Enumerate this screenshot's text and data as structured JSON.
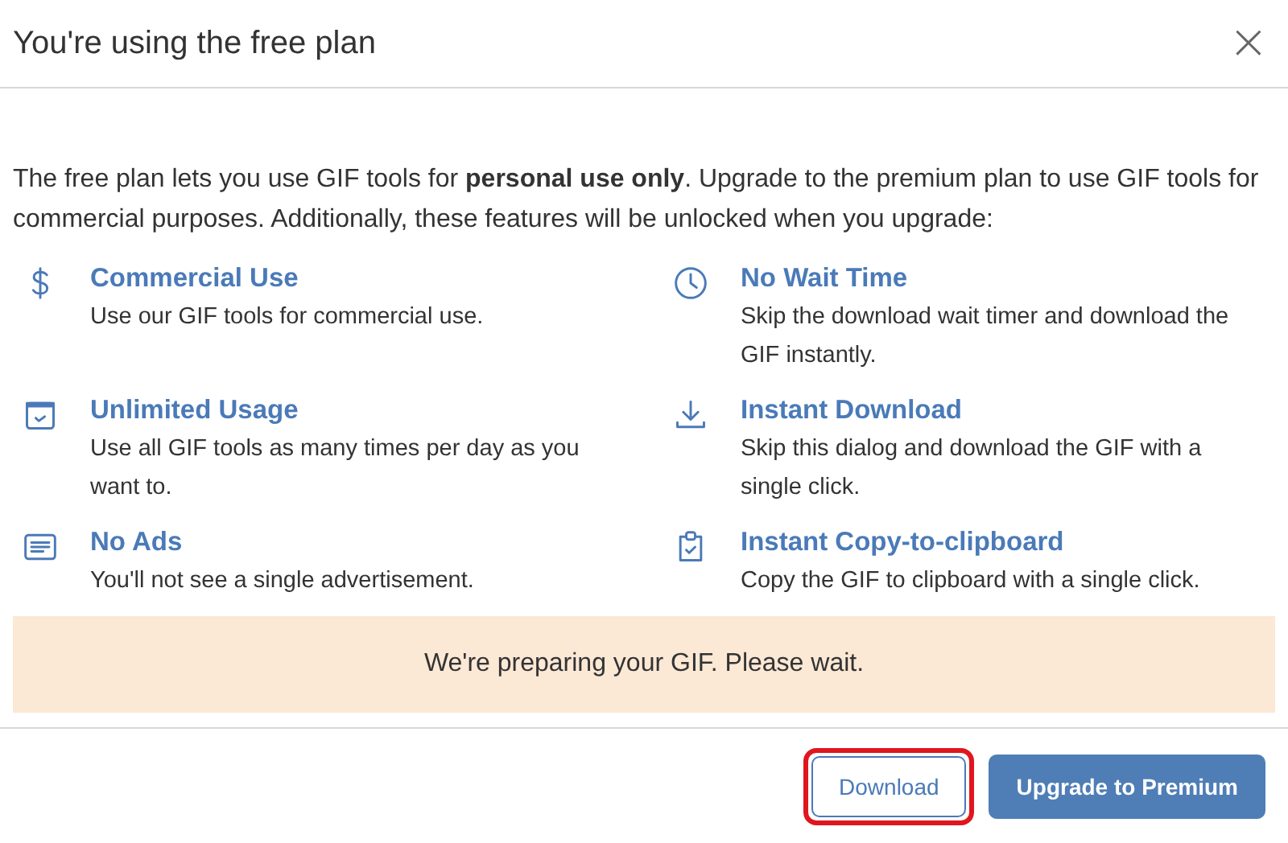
{
  "dialog": {
    "title": "You're using the free plan",
    "close": "×"
  },
  "intro": "The free plan lets you use GIF tools for **personal use only**. Upgrade to the premium plan to use GIF tools for commercial purposes. Additionally, these features will be unlocked when you upgrade:",
  "features": [
    {
      "kind": "dollar",
      "title": "Commercial Use",
      "description": "Use our GIF tools for commercial use."
    },
    {
      "kind": "clock",
      "title": "No Wait Time",
      "description": "Skip the download wait timer and download the GIF instantly."
    },
    {
      "kind": "calendar",
      "title": "Unlimited Usage",
      "description": "Use all GIF tools as many times per day as you want to."
    },
    {
      "kind": "download",
      "title": "Instant Download",
      "description": "Skip this dialog and download the GIF with a single click."
    },
    {
      "kind": "lines",
      "title": "No Ads",
      "description": "You'll not see a single advertisement."
    },
    {
      "kind": "clipboard",
      "title": "Instant Copy-to-clipboard",
      "description": "Copy the GIF to clipboard with a single click."
    }
  ],
  "notice": "We're preparing your GIF. Please wait.",
  "buttons": [
    {
      "kind": "secondary",
      "label": "Download",
      "highlighted": true
    },
    {
      "kind": "primary",
      "label": "Upgrade to Premium",
      "highlighted": false
    }
  ]
}
